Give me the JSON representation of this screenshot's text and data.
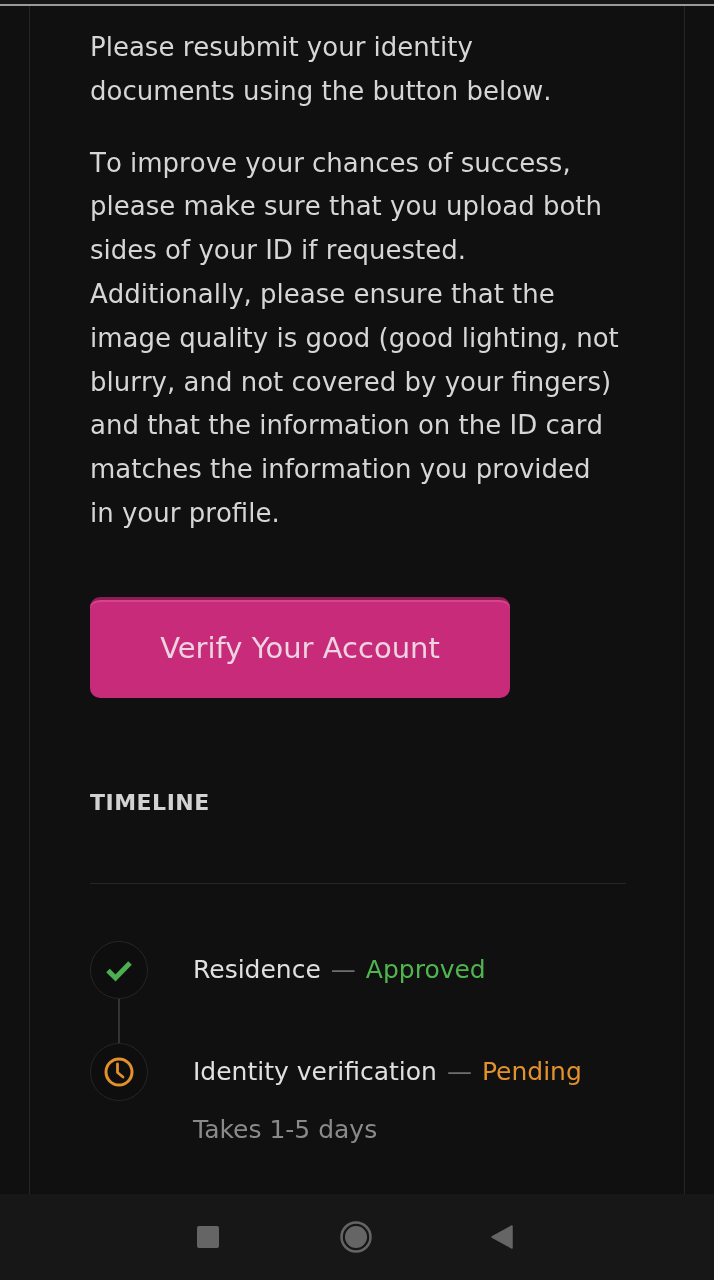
{
  "paragraphs": [
    "Please resubmit your identity documents using the button below.",
    "To improve your chances of success, please make sure that you upload both sides of your ID if requested. Additionally, please ensure that the image quality is good (good lighting, not blurry, and not covered by your fingers) and that the information on the ID card matches the information you provided in your profile."
  ],
  "button": {
    "label": "Verify Your Account"
  },
  "timeline": {
    "heading": "TIMELINE",
    "items": [
      {
        "kind": "approved",
        "title": "Residence",
        "separator": "—",
        "status": "Approved"
      },
      {
        "kind": "pending",
        "title": "Identity verification",
        "separator": "—",
        "status": "Pending",
        "note": "Takes 1-5 days"
      }
    ]
  }
}
